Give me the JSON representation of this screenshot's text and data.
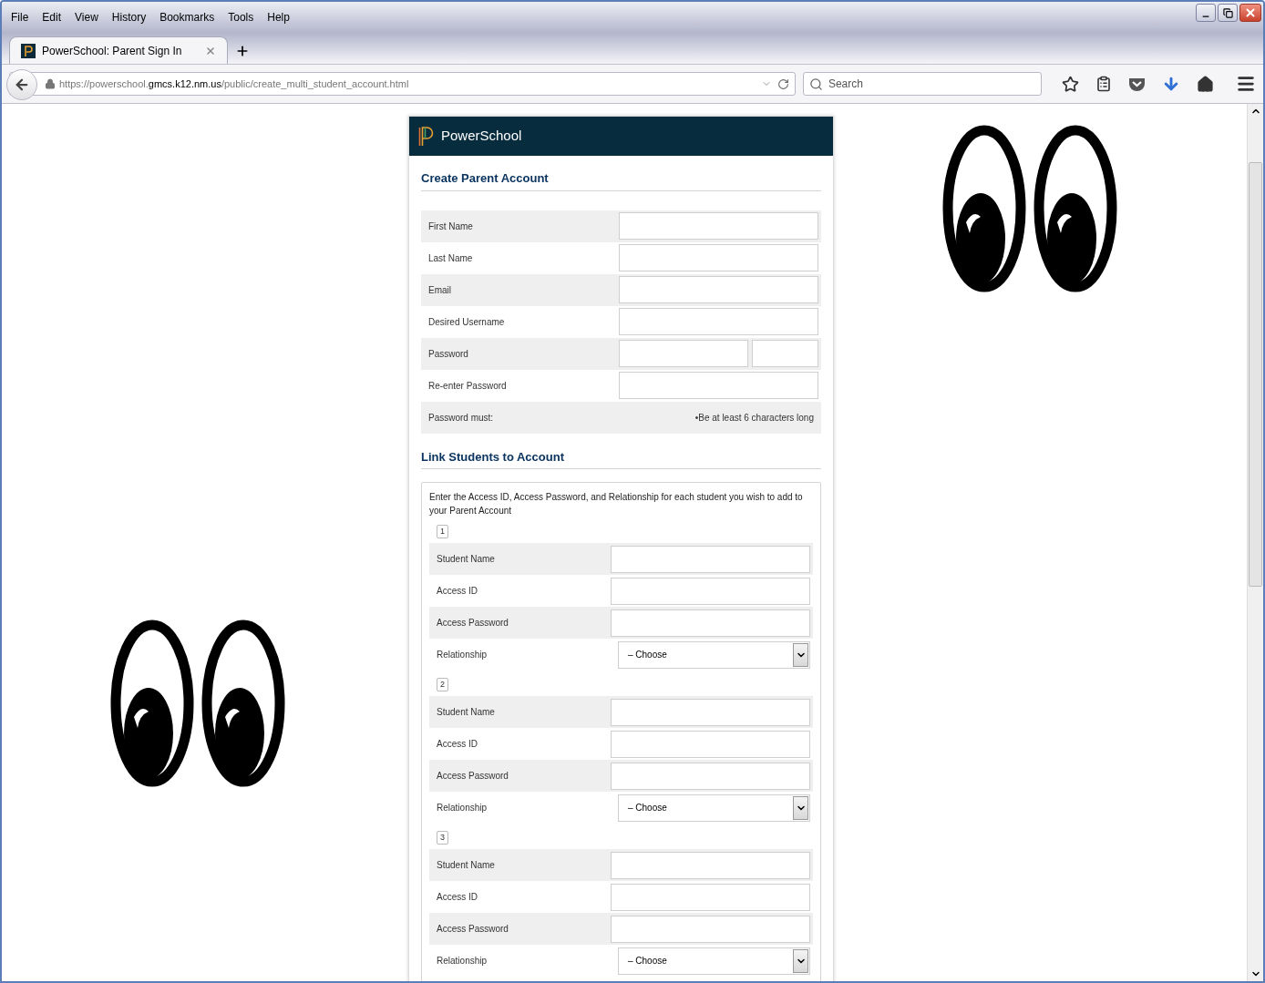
{
  "menu": [
    "File",
    "Edit",
    "View",
    "History",
    "Bookmarks",
    "Tools",
    "Help"
  ],
  "tabs": [
    {
      "label": "PowerSchool: Parent Sign In",
      "selected": true
    }
  ],
  "address": {
    "prefix": "https://powerschool.",
    "domain": "gmcs.k12.nm.us",
    "path": "/public/create_multi_student_account.html"
  },
  "search": {
    "placeholder": "Search"
  },
  "form": {
    "brand": "PowerSchool",
    "account_title": "Create Parent Account",
    "fields": [
      {
        "label": "First Name",
        "kind": "text"
      },
      {
        "label": "Last Name",
        "kind": "text"
      },
      {
        "label": "Email",
        "kind": "text"
      },
      {
        "label": "Desired Username",
        "kind": "text"
      },
      {
        "label": "Password",
        "kind": "password-pair"
      },
      {
        "label": "Re-enter Password",
        "kind": "text"
      }
    ],
    "password_rule": {
      "label": "Password must:",
      "text": "•Be at least 6 characters long"
    },
    "link_title": "Link Students to Account",
    "instructions": "Enter the Access ID, Access Password, and Relationship for each student you wish to add to your Parent Account",
    "students": [
      {
        "number": "1",
        "fields": [
          {
            "label": "Student Name",
            "kind": "text"
          },
          {
            "label": "Access ID",
            "kind": "text"
          },
          {
            "label": "Access Password",
            "kind": "text"
          },
          {
            "label": "Relationship",
            "kind": "select",
            "value": "– Choose"
          }
        ]
      },
      {
        "number": "2",
        "fields": [
          {
            "label": "Student Name",
            "kind": "text"
          },
          {
            "label": "Access ID",
            "kind": "text"
          },
          {
            "label": "Access Password",
            "kind": "text"
          },
          {
            "label": "Relationship",
            "kind": "select",
            "value": "– Choose"
          }
        ]
      },
      {
        "number": "3",
        "fields": [
          {
            "label": "Student Name",
            "kind": "text"
          },
          {
            "label": "Access ID",
            "kind": "text"
          },
          {
            "label": "Access Password",
            "kind": "text"
          },
          {
            "label": "Relationship",
            "kind": "select",
            "value": "– Choose"
          }
        ]
      }
    ]
  }
}
